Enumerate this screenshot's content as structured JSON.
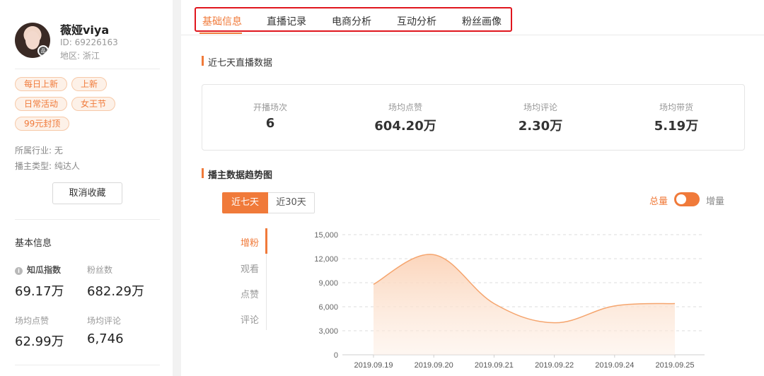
{
  "profile": {
    "name": "薇娅viya",
    "id_text": "ID:  69226163",
    "region_text": "地区:  浙江",
    "avatar_badge": "品牌"
  },
  "tags": [
    "每日上新",
    "上新",
    "日常活动",
    "女王节",
    "99元封顶"
  ],
  "meta": {
    "industry": "所属行业: 无",
    "anchor_type": "播主类型: 纯达人"
  },
  "fav_button": "取消收藏",
  "basic_info": {
    "title": "基本信息",
    "info_icon": "i",
    "stats": [
      {
        "label": "知瓜指数",
        "value": "69.17万"
      },
      {
        "label": "粉丝数",
        "value": "682.29万"
      },
      {
        "label": "场均点赞",
        "value": "62.99万"
      },
      {
        "label": "场均评论",
        "value": "6,746"
      }
    ]
  },
  "tabs": [
    {
      "label": "基础信息",
      "active": true
    },
    {
      "label": "直播记录",
      "active": false
    },
    {
      "label": "电商分析",
      "active": false
    },
    {
      "label": "互动分析",
      "active": false
    },
    {
      "label": "粉丝画像",
      "active": false
    }
  ],
  "summary": {
    "title": "近七天直播数据",
    "items": [
      {
        "label": "开播场次",
        "value": "6"
      },
      {
        "label": "场均点赞",
        "value": "604.20万"
      },
      {
        "label": "场均评论",
        "value": "2.30万"
      },
      {
        "label": "场均带货",
        "value": "5.19万"
      }
    ]
  },
  "trend": {
    "title": "播主数据趋势图",
    "range_buttons": [
      "近七天",
      "近30天"
    ],
    "toggle_left": "总量",
    "toggle_right": "增量",
    "metrics": [
      "增粉",
      "观看",
      "点赞",
      "评论"
    ]
  },
  "colors": {
    "accent": "#f07a3a",
    "highlight_border": "#e0161e"
  },
  "chart_data": {
    "type": "area",
    "x": [
      "2019.09.19",
      "2019.09.20",
      "2019.09.21",
      "2019.09.22",
      "2019.09.24",
      "2019.09.25"
    ],
    "series": [
      {
        "values": [
          8800,
          12500,
          6400,
          4000,
          6100,
          6400
        ]
      }
    ],
    "yticks": [
      0,
      3000,
      6000,
      9000,
      12000,
      15000
    ],
    "ytick_labels": [
      "0",
      "3,000",
      "6,000",
      "9,000",
      "12,000",
      "15,000"
    ],
    "ylim": [
      0,
      15000
    ],
    "grid": true,
    "color": "#f5a56e"
  }
}
